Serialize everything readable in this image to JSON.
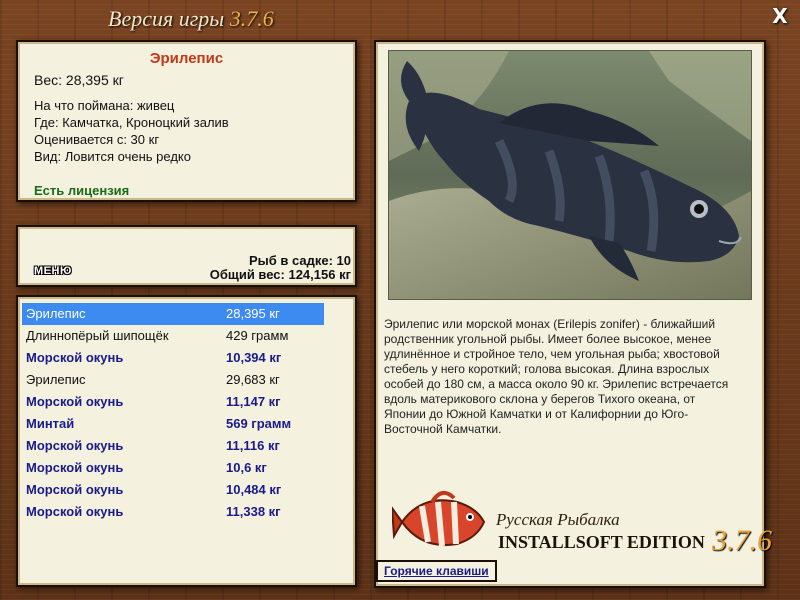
{
  "window": {
    "title": "Версия игры ",
    "version": "3.7.6",
    "close_label": "X"
  },
  "info": {
    "fish_name": "Эрилепис",
    "weight": "Вес: 28,395 кг",
    "caught_with": "На что поймана: живец",
    "location": "Где: Камчатка, Кроноцкий залив",
    "valued_from": "Оценивается с: 30 кг",
    "rarity": "Вид: Ловится очень редко",
    "license": "Есть лицензия"
  },
  "summary": {
    "menu_label": "МЕНЮ",
    "fish_in_keepnet": "Рыб в садке: 10",
    "total_weight": "Общий вес: 124,156 кг"
  },
  "catch_list": [
    {
      "name": "Эрилепис",
      "weight": "28,395 кг",
      "style": "selected"
    },
    {
      "name": "Длиннопёрый шипощёк",
      "weight": "429 грамм",
      "style": "normal"
    },
    {
      "name": "Морской окунь",
      "weight": "10,394 кг",
      "style": "bold"
    },
    {
      "name": "Эрилепис",
      "weight": "29,683 кг",
      "style": "normal"
    },
    {
      "name": "Морской окунь",
      "weight": "11,147 кг",
      "style": "bold"
    },
    {
      "name": "Минтай",
      "weight": "569 грамм",
      "style": "bold"
    },
    {
      "name": "Морской окунь",
      "weight": "11,116 кг",
      "style": "bold"
    },
    {
      "name": "Морской окунь",
      "weight": "10,6 кг",
      "style": "bold"
    },
    {
      "name": "Морской окунь",
      "weight": "10,484 кг",
      "style": "bold"
    },
    {
      "name": "Морской окунь",
      "weight": "11,338 кг",
      "style": "bold"
    }
  ],
  "detail": {
    "photo_icon": "fish-photo",
    "description": "Эрилепис или морской монах (Erilepis zonifer) - ближайший родственник угольной рыбы. Имеет более высокое, менее удлинённое и стройное тело, чем угольная рыба; хвостовой стебель у него короткий; голова высокая. Длина взрослых особей до 180 см, а масса около 90 кг. Эрилепис встречается вдоль материкового склона у берегов Тихого океана, от Японии до Южной Камчатки и от Калифорнии до Юго-Восточной Камчатки."
  },
  "brand": {
    "line1": "Русская Рыбалка",
    "line2": "INSTALLSOFT EDITION",
    "version": "3.7.6",
    "logo_icon": "red-fish-logo"
  },
  "hotkeys_label": "Горячие клавиши",
  "colors": {
    "accent": "#c0391b",
    "license": "#1a6a1a",
    "list_bold": "#1a1a8c",
    "selected": "#3d8bf0",
    "version": "#f0b24a"
  }
}
